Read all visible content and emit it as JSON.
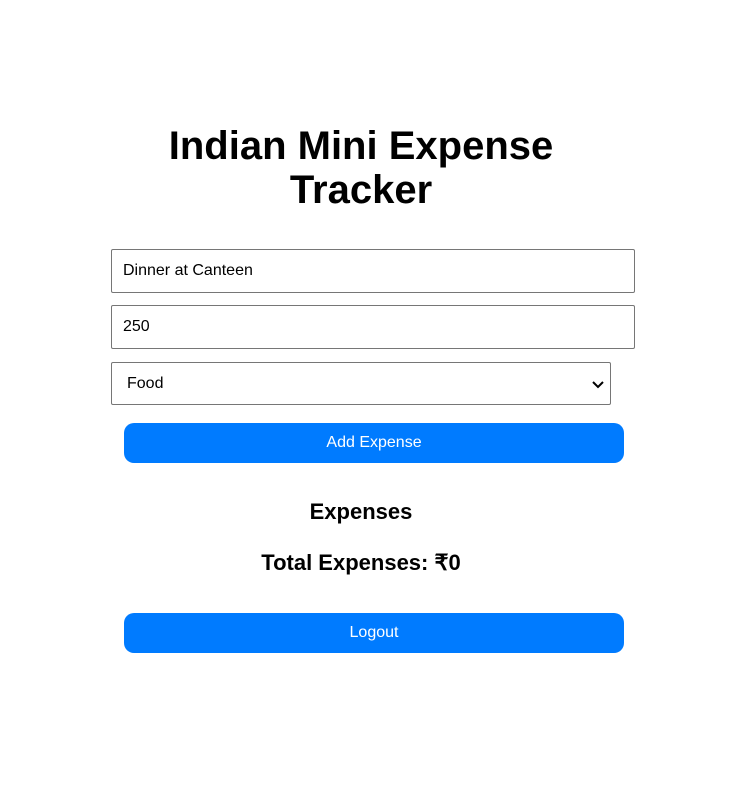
{
  "title": "Indian Mini Expense Tracker",
  "form": {
    "description_value": "Dinner at Canteen",
    "amount_value": "250",
    "category_selected": "Food",
    "add_label": "Add Expense"
  },
  "expenses_heading": "Expenses",
  "total_label": "Total Expenses: ₹0",
  "logout_label": "Logout",
  "colors": {
    "accent": "#007bff"
  },
  "icons": {
    "select": "chevron-down-icon"
  }
}
